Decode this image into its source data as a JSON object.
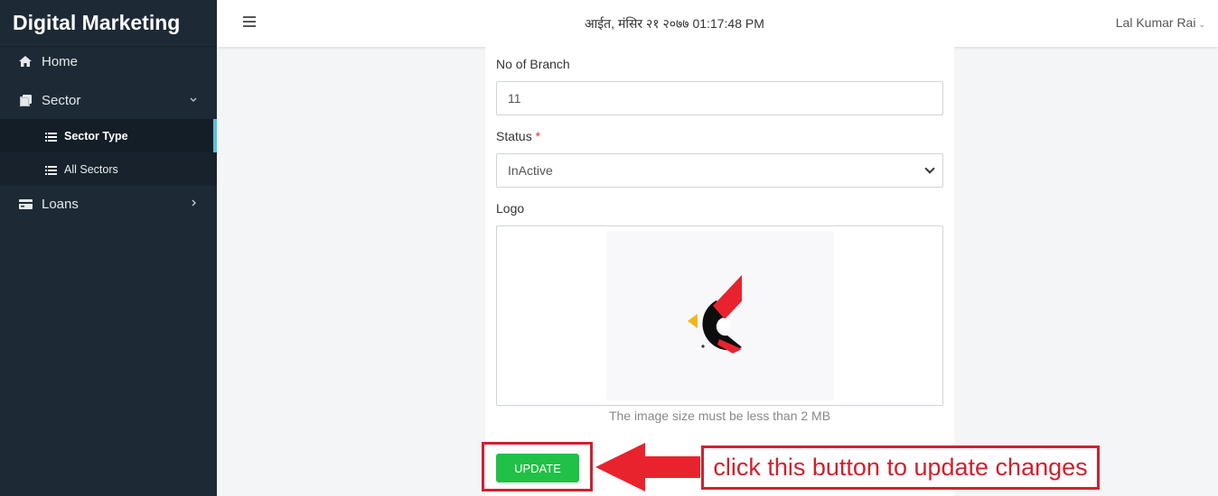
{
  "sidebar": {
    "brand": "Digital Marketing",
    "items": [
      {
        "label": "Home",
        "icon": "home-icon"
      },
      {
        "label": "Sector",
        "icon": "clone-icon",
        "expanded": true,
        "children": [
          {
            "label": "Sector Type",
            "icon": "list-icon",
            "active": true
          },
          {
            "label": "All Sectors",
            "icon": "list-icon"
          }
        ]
      },
      {
        "label": "Loans",
        "icon": "wallet-icon"
      }
    ],
    "colors": {
      "background": "#1d2a35",
      "active_indicator": "#5bc0de"
    }
  },
  "topbar": {
    "datetime": "आईत, मंसिर २१ २०७७ 01:17:48 PM",
    "user": "Lal Kumar Rai"
  },
  "form": {
    "branch_label": "No of Branch",
    "branch_value": "11",
    "status_label": "Status",
    "status_required": "*",
    "status_value": "InActive",
    "logo_label": "Logo",
    "logo_hint": "The image size must be less than 2 MB",
    "update_label": "UPDATE",
    "colors": {
      "update_button": "#21c046",
      "required": "#e3342f"
    }
  },
  "annotation": {
    "text": "click this button to update changes",
    "color": "#d0202e"
  }
}
